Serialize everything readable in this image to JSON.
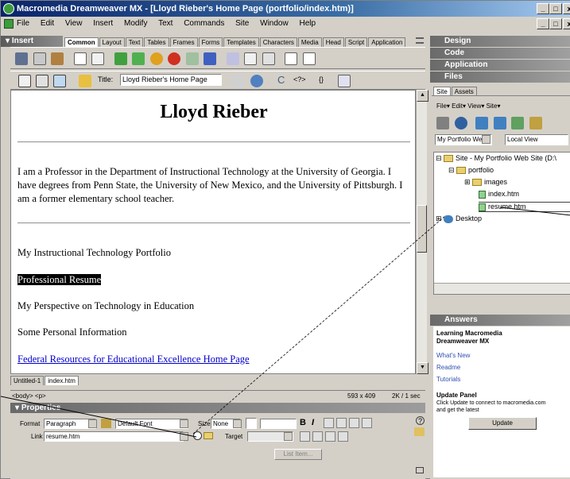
{
  "window": {
    "title": "Macromedia Dreamweaver MX - [Lloyd Rieber's Home Page (portfolio/index.htm)]",
    "btn_min": "_",
    "btn_max": "□",
    "btn_close": "x",
    "btn_min2": "_",
    "btn_max2": "□",
    "btn_close2": "x"
  },
  "menu": [
    "File",
    "Edit",
    "View",
    "Insert",
    "Modify",
    "Text",
    "Commands",
    "Site",
    "Window",
    "Help"
  ],
  "insert_panel": {
    "title": "Insert",
    "tabs": [
      "Common",
      "Layout",
      "Text",
      "Tables",
      "Frames",
      "Forms",
      "Templates",
      "Characters",
      "Media",
      "Head",
      "Script",
      "Application"
    ],
    "active_tab": "Common"
  },
  "doc_toolbar": {
    "title_label": "Title:",
    "title_value": "Lloyd Rieber's Home Page",
    "code_symbol": "<?>",
    "braces": "{}"
  },
  "document": {
    "heading": "Lloyd Rieber",
    "bio": "I am a Professor in the Department of Instructional Technology at the University of Georgia. I have degrees from Penn State, the University of New Mexico, and the University of Pittsburgh. I am a former elementary school teacher.",
    "items": [
      "My Instructional Technology Portfolio",
      "Professional Resume",
      "My Perspective on Technology in Education",
      "Some Personal Information"
    ],
    "link": "Federal Resources for Educational Excellence Home Page"
  },
  "doc_tabs": [
    "Untitled-1",
    "index.htm"
  ],
  "status": {
    "tags": "<body> <p>",
    "size": "593 x 409",
    "weight": "2K / 1 sec"
  },
  "properties": {
    "title": "Properties",
    "format_label": "Format",
    "format_value": "Paragraph",
    "font_value": "Default Font",
    "size_label": "Size",
    "size_value": "None",
    "link_label": "Link",
    "link_value": "resume.htm",
    "target_label": "Target",
    "list_item": "List Item...",
    "bold": "B",
    "italic": "I",
    "help": "?"
  },
  "right_panels": {
    "design": "Design",
    "code": "Code",
    "application": "Application",
    "files": "Files",
    "answers": "Answers"
  },
  "files_panel": {
    "tabs": [
      "Site",
      "Assets"
    ],
    "menu": [
      "File",
      "Edit",
      "View",
      "Site"
    ],
    "site_select": "My Portfolio We",
    "view_select": "Local View",
    "tree": [
      "Site - My Portfolio Web Site (D:\\",
      "portfolio",
      "images",
      "index.htm",
      "resume.htm",
      "Desktop"
    ]
  },
  "answers_panel": {
    "learn_title": "Learning Macromedia Dreamweaver MX",
    "links": [
      "What's New",
      "Readme",
      "Tutorials"
    ],
    "update_title": "Update Panel",
    "update_text": "Click Update to connect to macromedia.com and get the latest",
    "update_button": "Update"
  }
}
